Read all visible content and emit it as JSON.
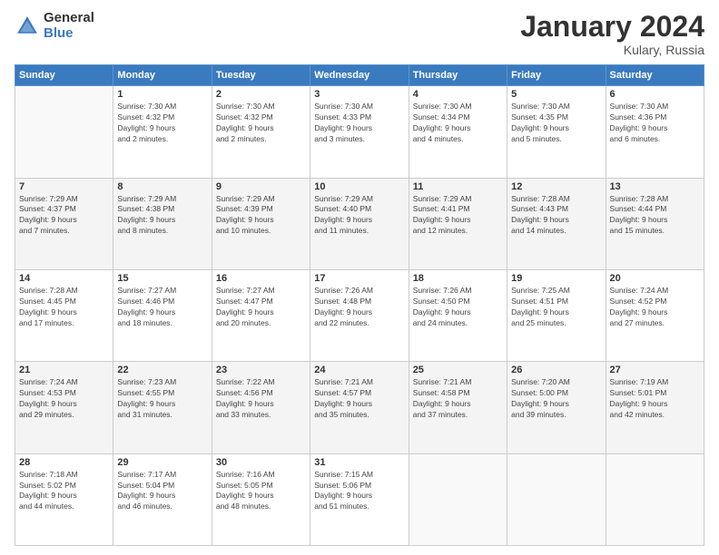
{
  "header": {
    "logo_general": "General",
    "logo_blue": "Blue",
    "month_title": "January 2024",
    "subtitle": "Kulary, Russia"
  },
  "days_of_week": [
    "Sunday",
    "Monday",
    "Tuesday",
    "Wednesday",
    "Thursday",
    "Friday",
    "Saturday"
  ],
  "weeks": [
    [
      {
        "day": "",
        "info": ""
      },
      {
        "day": "1",
        "info": "Sunrise: 7:30 AM\nSunset: 4:32 PM\nDaylight: 9 hours\nand 2 minutes."
      },
      {
        "day": "2",
        "info": "Sunrise: 7:30 AM\nSunset: 4:32 PM\nDaylight: 9 hours\nand 2 minutes."
      },
      {
        "day": "3",
        "info": "Sunrise: 7:30 AM\nSunset: 4:33 PM\nDaylight: 9 hours\nand 3 minutes."
      },
      {
        "day": "4",
        "info": "Sunrise: 7:30 AM\nSunset: 4:34 PM\nDaylight: 9 hours\nand 4 minutes."
      },
      {
        "day": "5",
        "info": "Sunrise: 7:30 AM\nSunset: 4:35 PM\nDaylight: 9 hours\nand 5 minutes."
      },
      {
        "day": "6",
        "info": "Sunrise: 7:30 AM\nSunset: 4:36 PM\nDaylight: 9 hours\nand 6 minutes."
      }
    ],
    [
      {
        "day": "7",
        "info": "Sunrise: 7:29 AM\nSunset: 4:37 PM\nDaylight: 9 hours\nand 7 minutes."
      },
      {
        "day": "8",
        "info": "Sunrise: 7:29 AM\nSunset: 4:38 PM\nDaylight: 9 hours\nand 8 minutes."
      },
      {
        "day": "9",
        "info": "Sunrise: 7:29 AM\nSunset: 4:39 PM\nDaylight: 9 hours\nand 10 minutes."
      },
      {
        "day": "10",
        "info": "Sunrise: 7:29 AM\nSunset: 4:40 PM\nDaylight: 9 hours\nand 11 minutes."
      },
      {
        "day": "11",
        "info": "Sunrise: 7:29 AM\nSunset: 4:41 PM\nDaylight: 9 hours\nand 12 minutes."
      },
      {
        "day": "12",
        "info": "Sunrise: 7:28 AM\nSunset: 4:43 PM\nDaylight: 9 hours\nand 14 minutes."
      },
      {
        "day": "13",
        "info": "Sunrise: 7:28 AM\nSunset: 4:44 PM\nDaylight: 9 hours\nand 15 minutes."
      }
    ],
    [
      {
        "day": "14",
        "info": "Sunrise: 7:28 AM\nSunset: 4:45 PM\nDaylight: 9 hours\nand 17 minutes."
      },
      {
        "day": "15",
        "info": "Sunrise: 7:27 AM\nSunset: 4:46 PM\nDaylight: 9 hours\nand 18 minutes."
      },
      {
        "day": "16",
        "info": "Sunrise: 7:27 AM\nSunset: 4:47 PM\nDaylight: 9 hours\nand 20 minutes."
      },
      {
        "day": "17",
        "info": "Sunrise: 7:26 AM\nSunset: 4:48 PM\nDaylight: 9 hours\nand 22 minutes."
      },
      {
        "day": "18",
        "info": "Sunrise: 7:26 AM\nSunset: 4:50 PM\nDaylight: 9 hours\nand 24 minutes."
      },
      {
        "day": "19",
        "info": "Sunrise: 7:25 AM\nSunset: 4:51 PM\nDaylight: 9 hours\nand 25 minutes."
      },
      {
        "day": "20",
        "info": "Sunrise: 7:24 AM\nSunset: 4:52 PM\nDaylight: 9 hours\nand 27 minutes."
      }
    ],
    [
      {
        "day": "21",
        "info": "Sunrise: 7:24 AM\nSunset: 4:53 PM\nDaylight: 9 hours\nand 29 minutes."
      },
      {
        "day": "22",
        "info": "Sunrise: 7:23 AM\nSunset: 4:55 PM\nDaylight: 9 hours\nand 31 minutes."
      },
      {
        "day": "23",
        "info": "Sunrise: 7:22 AM\nSunset: 4:56 PM\nDaylight: 9 hours\nand 33 minutes."
      },
      {
        "day": "24",
        "info": "Sunrise: 7:21 AM\nSunset: 4:57 PM\nDaylight: 9 hours\nand 35 minutes."
      },
      {
        "day": "25",
        "info": "Sunrise: 7:21 AM\nSunset: 4:58 PM\nDaylight: 9 hours\nand 37 minutes."
      },
      {
        "day": "26",
        "info": "Sunrise: 7:20 AM\nSunset: 5:00 PM\nDaylight: 9 hours\nand 39 minutes."
      },
      {
        "day": "27",
        "info": "Sunrise: 7:19 AM\nSunset: 5:01 PM\nDaylight: 9 hours\nand 42 minutes."
      }
    ],
    [
      {
        "day": "28",
        "info": "Sunrise: 7:18 AM\nSunset: 5:02 PM\nDaylight: 9 hours\nand 44 minutes."
      },
      {
        "day": "29",
        "info": "Sunrise: 7:17 AM\nSunset: 5:04 PM\nDaylight: 9 hours\nand 46 minutes."
      },
      {
        "day": "30",
        "info": "Sunrise: 7:16 AM\nSunset: 5:05 PM\nDaylight: 9 hours\nand 48 minutes."
      },
      {
        "day": "31",
        "info": "Sunrise: 7:15 AM\nSunset: 5:06 PM\nDaylight: 9 hours\nand 51 minutes."
      },
      {
        "day": "",
        "info": ""
      },
      {
        "day": "",
        "info": ""
      },
      {
        "day": "",
        "info": ""
      }
    ]
  ]
}
